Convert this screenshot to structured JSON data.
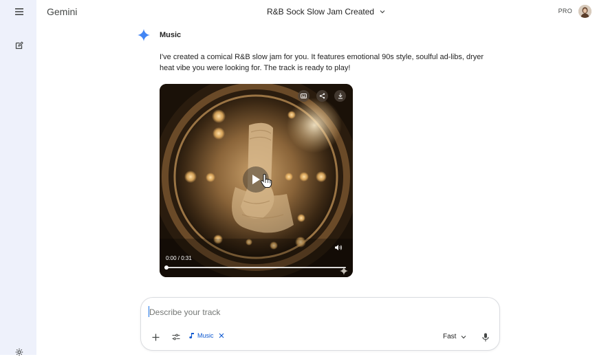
{
  "app": {
    "name": "Gemini",
    "chat_title": "R&B Sock Slow Jam Created",
    "plan": "PRO"
  },
  "message": {
    "model_label": "Music",
    "text": "I've created a comical R&B slow jam for you. It features emotional 90s style, soulful ad-libs, dryer heat vibe you were looking for. The track is ready to play!"
  },
  "player": {
    "time": "0:00 / 0:31",
    "progress": 0.0
  },
  "composer": {
    "placeholder": "Describe your track",
    "value": "",
    "chip_label": "Music",
    "mode_label": "Fast"
  },
  "colors": {
    "sidebar": "#eef1fb",
    "accent": "#0b57d0",
    "star": "#4285f4"
  }
}
